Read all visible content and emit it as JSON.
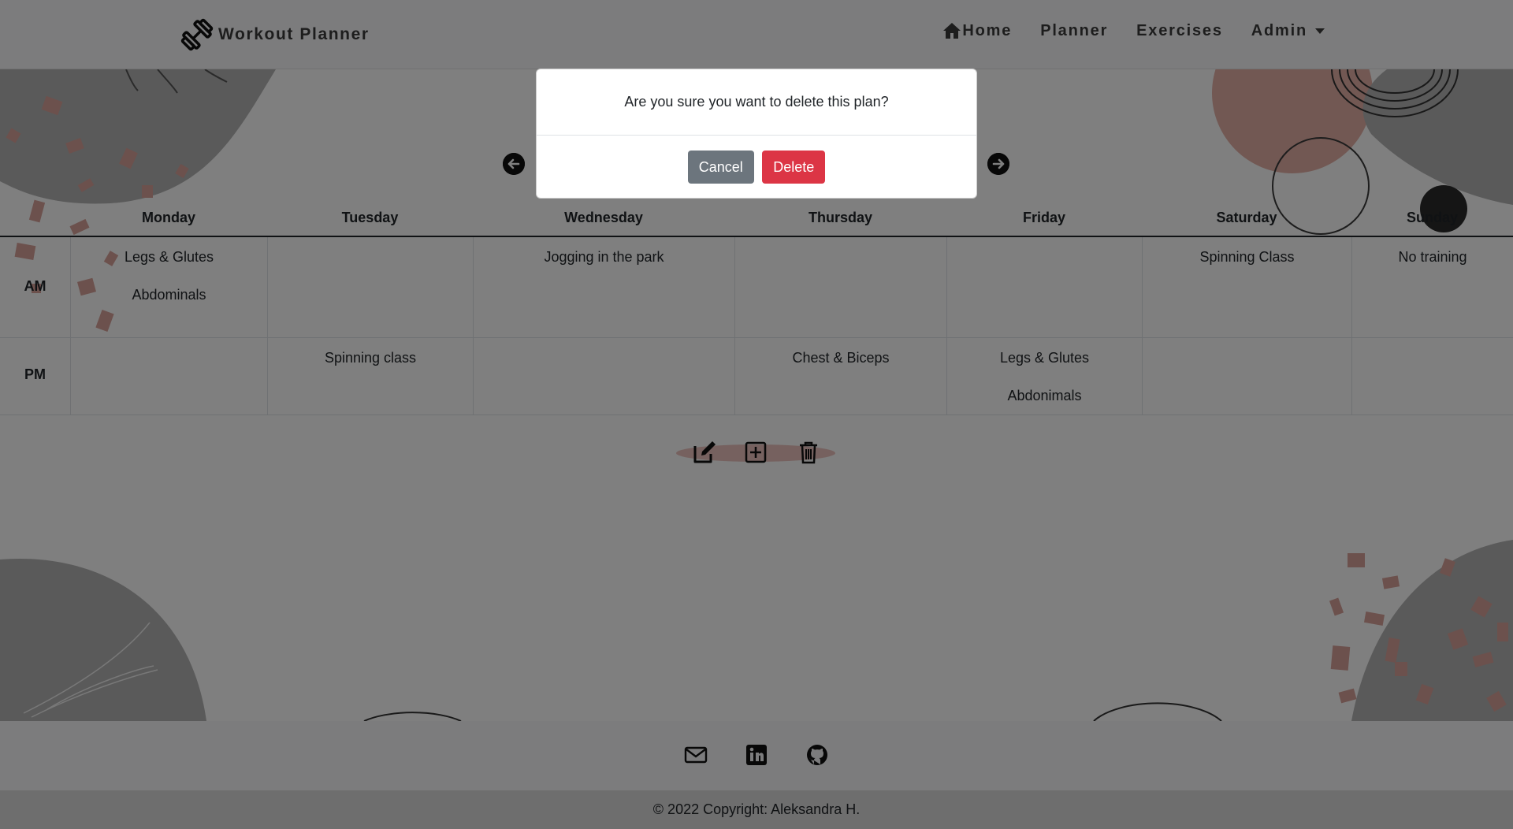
{
  "navbar": {
    "brand": "Workout Planner",
    "links": [
      {
        "label": "Home",
        "icon": "home-icon"
      },
      {
        "label": "Planner"
      },
      {
        "label": "Exercises"
      },
      {
        "label": "Admin",
        "dropdown": true
      }
    ]
  },
  "planner": {
    "days": [
      "Monday",
      "Tuesday",
      "Wednesday",
      "Thursday",
      "Friday",
      "Saturday",
      "Sunday"
    ],
    "rows": [
      {
        "label": "AM",
        "cells": [
          [
            "Legs & Glutes",
            "Abdominals"
          ],
          [],
          [
            "Jogging in the park"
          ],
          [],
          [],
          [
            "Spinning Class"
          ],
          [
            "No training"
          ]
        ]
      },
      {
        "label": "PM",
        "cells": [
          [],
          [
            "Spinning class"
          ],
          [],
          [
            "Chest & Biceps"
          ],
          [
            "Legs & Glutes",
            "Abdonimals"
          ],
          [],
          []
        ]
      }
    ],
    "actions": [
      "edit-icon",
      "add-icon",
      "trash-icon"
    ]
  },
  "modal": {
    "message": "Are you sure you want to delete this plan?",
    "cancel_label": "Cancel",
    "delete_label": "Delete"
  },
  "footer": {
    "icons": [
      "envelope-icon",
      "linkedin-icon",
      "github-icon"
    ],
    "copyright": "© 2022 Copyright: Aleksandra H."
  },
  "colors": {
    "accent_pink": "#e9b8b3",
    "cancel": "#6c757d",
    "delete": "#dc3545",
    "overlay": "rgba(0,0,0,0.5)"
  }
}
